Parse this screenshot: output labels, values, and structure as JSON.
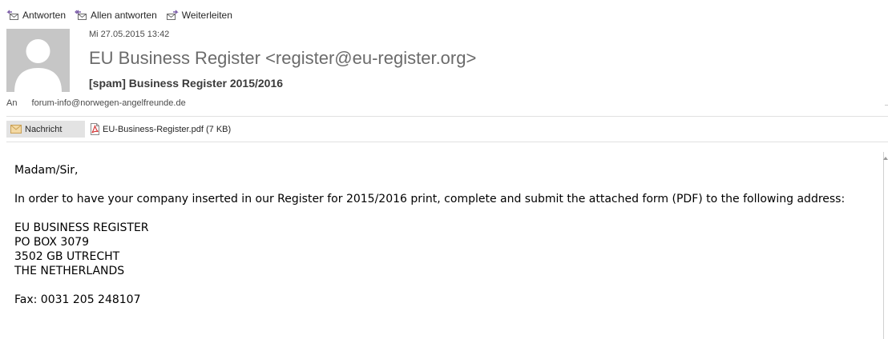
{
  "toolbar": {
    "reply": "Antworten",
    "reply_all": "Allen antworten",
    "forward": "Weiterleiten"
  },
  "message": {
    "date": "Mi 27.05.2015 13:42",
    "sender": "EU Business Register <register@eu-register.org>",
    "subject": "[spam] Business Register 2015/2016",
    "to_label": "An",
    "to_address": "forum-info@norwegen-angelfreunde.de"
  },
  "attachments": {
    "message_tab": "Nachricht",
    "file": "EU-Business-Register.pdf (7 KB)"
  },
  "body": {
    "greeting": "Madam/Sir,",
    "paragraph1": "In order to have your company inserted in our Register for 2015/2016 print, complete and submit the attached form (PDF) to the following address:",
    "address_line1": "EU BUSINESS REGISTER",
    "address_line2": "PO BOX 3079",
    "address_line3": "3502 GB UTRECHT",
    "address_line4": "THE NETHERLANDS",
    "fax": "Fax: 0031 205 248107"
  },
  "colors": {
    "avatar_bg": "#c6c6c6",
    "sender_text": "#6b6b6b",
    "icon_accent": "#7c5ea8",
    "message_tab_bg": "#e3e3e3",
    "pdf_red": "#d22f2f"
  },
  "icons": {
    "reply": "reply-icon",
    "reply_all": "reply-all-icon",
    "forward": "forward-icon",
    "message": "envelope-icon",
    "pdf": "pdf-file-icon",
    "avatar": "default-person-icon"
  }
}
